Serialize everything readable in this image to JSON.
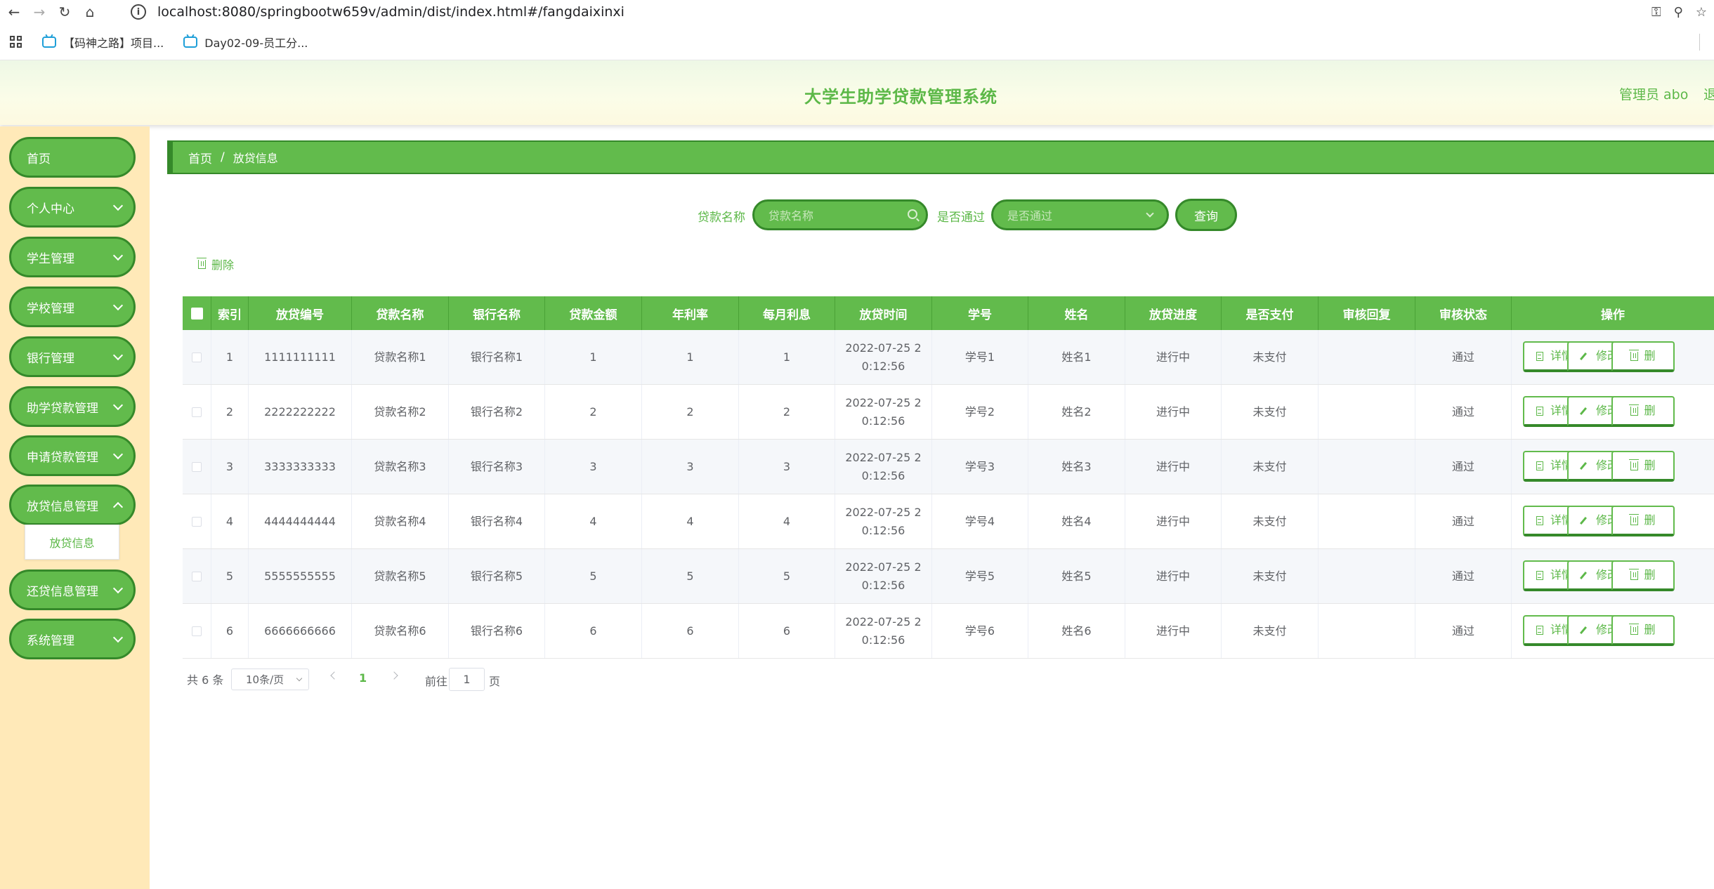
{
  "browser": {
    "url": "localhost:8080/springbootw659v/admin/dist/index.html#/fangdaixinxi",
    "bookmarks": [
      "【码神之路】项目...",
      "Day02-09-员工分..."
    ]
  },
  "header": {
    "title": "大学生助学贷款管理系统",
    "admin": "管理员 abo",
    "logout": "退"
  },
  "sidebar": {
    "items": [
      {
        "label": "首页",
        "has_chevron": false
      },
      {
        "label": "个人中心",
        "has_chevron": true
      },
      {
        "label": "学生管理",
        "has_chevron": true
      },
      {
        "label": "学校管理",
        "has_chevron": true
      },
      {
        "label": "银行管理",
        "has_chevron": true
      },
      {
        "label": "助学贷款管理",
        "has_chevron": true
      },
      {
        "label": "申请贷款管理",
        "has_chevron": true
      },
      {
        "label": "放贷信息管理",
        "has_chevron": true,
        "open": true
      },
      {
        "label": "还贷信息管理",
        "has_chevron": true
      },
      {
        "label": "系统管理",
        "has_chevron": true
      }
    ],
    "submenu": "放贷信息"
  },
  "breadcrumb": {
    "home": "首页",
    "sep": "/",
    "current": "放贷信息"
  },
  "search": {
    "name_label": "贷款名称",
    "name_placeholder": "贷款名称",
    "pass_label": "是否通过",
    "pass_placeholder": "是否通过",
    "query": "查询"
  },
  "actions": {
    "delete": "删除"
  },
  "table": {
    "columns": [
      "索引",
      "放贷编号",
      "贷款名称",
      "银行名称",
      "贷款金额",
      "年利率",
      "每月利息",
      "放贷时间",
      "学号",
      "姓名",
      "放贷进度",
      "是否支付",
      "审核回复",
      "审核状态",
      "操作"
    ],
    "rows": [
      {
        "index": "1",
        "code": "1111111111",
        "loan": "贷款名称1",
        "bank": "银行名称1",
        "amount": "1",
        "rate": "1",
        "interest": "1",
        "time1": "2022-07-25 2",
        "time2": "0:12:56",
        "sid": "学号1",
        "name": "姓名1",
        "progress": "进行中",
        "paid": "未支付",
        "reply": "",
        "status": "通过"
      },
      {
        "index": "2",
        "code": "2222222222",
        "loan": "贷款名称2",
        "bank": "银行名称2",
        "amount": "2",
        "rate": "2",
        "interest": "2",
        "time1": "2022-07-25 2",
        "time2": "0:12:56",
        "sid": "学号2",
        "name": "姓名2",
        "progress": "进行中",
        "paid": "未支付",
        "reply": "",
        "status": "通过"
      },
      {
        "index": "3",
        "code": "3333333333",
        "loan": "贷款名称3",
        "bank": "银行名称3",
        "amount": "3",
        "rate": "3",
        "interest": "3",
        "time1": "2022-07-25 2",
        "time2": "0:12:56",
        "sid": "学号3",
        "name": "姓名3",
        "progress": "进行中",
        "paid": "未支付",
        "reply": "",
        "status": "通过"
      },
      {
        "index": "4",
        "code": "4444444444",
        "loan": "贷款名称4",
        "bank": "银行名称4",
        "amount": "4",
        "rate": "4",
        "interest": "4",
        "time1": "2022-07-25 2",
        "time2": "0:12:56",
        "sid": "学号4",
        "name": "姓名4",
        "progress": "进行中",
        "paid": "未支付",
        "reply": "",
        "status": "通过"
      },
      {
        "index": "5",
        "code": "5555555555",
        "loan": "贷款名称5",
        "bank": "银行名称5",
        "amount": "5",
        "rate": "5",
        "interest": "5",
        "time1": "2022-07-25 2",
        "time2": "0:12:56",
        "sid": "学号5",
        "name": "姓名5",
        "progress": "进行中",
        "paid": "未支付",
        "reply": "",
        "status": "通过"
      },
      {
        "index": "6",
        "code": "6666666666",
        "loan": "贷款名称6",
        "bank": "银行名称6",
        "amount": "6",
        "rate": "6",
        "interest": "6",
        "time1": "2022-07-25 2",
        "time2": "0:12:56",
        "sid": "学号6",
        "name": "姓名6",
        "progress": "进行中",
        "paid": "未支付",
        "reply": "",
        "status": "通过"
      }
    ],
    "ops": {
      "detail": "详情",
      "edit": "修改",
      "delete": "删"
    }
  },
  "pagination": {
    "total": "共 6 条",
    "page_size": "10条/页",
    "current": "1",
    "goto_prefix": "前往",
    "goto_value": "1",
    "goto_suffix": "页"
  },
  "colors": {
    "primary": "#62bb4c",
    "primary_dark": "#35892a",
    "sidebar_bg": "#ffe9b8",
    "text_green": "#5cb848"
  }
}
